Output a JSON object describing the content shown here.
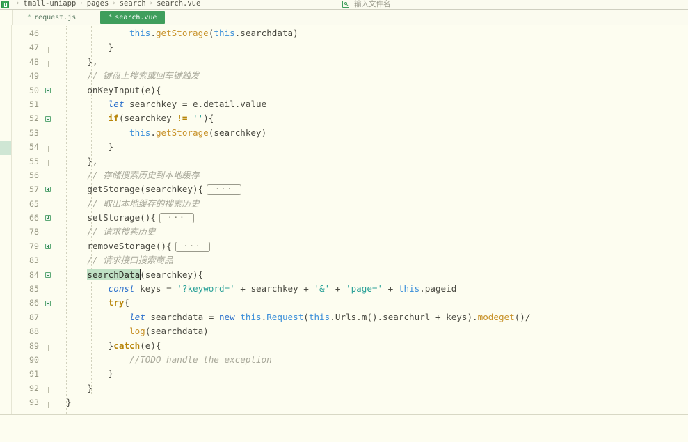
{
  "breadcrumb": {
    "app_icon": "app-logo-icon",
    "items": [
      "tmall-uniapp",
      "pages",
      "search",
      "search.vue"
    ],
    "separator": "›"
  },
  "search": {
    "icon": "search-icon",
    "placeholder": "输入文件名",
    "value": ""
  },
  "tabs": [
    {
      "label": "request.js",
      "modified_marker": "*",
      "active": false
    },
    {
      "label": "search.vue",
      "modified_marker": "*",
      "active": true
    }
  ],
  "editor": {
    "fold_placeholder": "···",
    "selection": "searchData",
    "lines": [
      {
        "num": "46",
        "fold": "none",
        "indent": 0
      },
      {
        "num": "47",
        "fold": "tick",
        "indent": 0
      },
      {
        "num": "48",
        "fold": "tick",
        "indent": 0
      },
      {
        "num": "49",
        "fold": "none",
        "indent": 0
      },
      {
        "num": "50",
        "fold": "expanded",
        "indent": 0
      },
      {
        "num": "51",
        "fold": "none",
        "indent": 0
      },
      {
        "num": "52",
        "fold": "expanded",
        "indent": 0
      },
      {
        "num": "53",
        "fold": "none",
        "indent": 0
      },
      {
        "num": "54",
        "fold": "tick",
        "indent": 0
      },
      {
        "num": "55",
        "fold": "tick",
        "indent": 0
      },
      {
        "num": "56",
        "fold": "none",
        "indent": 0
      },
      {
        "num": "57",
        "fold": "collapsed",
        "indent": 0
      },
      {
        "num": "65",
        "fold": "none",
        "indent": 0
      },
      {
        "num": "66",
        "fold": "collapsed",
        "indent": 0
      },
      {
        "num": "78",
        "fold": "none",
        "indent": 0
      },
      {
        "num": "79",
        "fold": "collapsed",
        "indent": 0
      },
      {
        "num": "83",
        "fold": "none",
        "indent": 0
      },
      {
        "num": "84",
        "fold": "expanded",
        "indent": 0
      },
      {
        "num": "85",
        "fold": "none",
        "indent": 0
      },
      {
        "num": "86",
        "fold": "expanded",
        "indent": 0
      },
      {
        "num": "87",
        "fold": "none",
        "indent": 0
      },
      {
        "num": "88",
        "fold": "none",
        "indent": 0
      },
      {
        "num": "89",
        "fold": "tick",
        "indent": 0
      },
      {
        "num": "90",
        "fold": "none",
        "indent": 0
      },
      {
        "num": "91",
        "fold": "none",
        "indent": 0
      },
      {
        "num": "92",
        "fold": "tick",
        "indent": 0
      },
      {
        "num": "93",
        "fold": "tick",
        "indent": 0
      }
    ],
    "code": {
      "l46": "            this.getStorage(this.searchdata)",
      "l47": "        }",
      "l48": "    },",
      "l49": "    // 键盘上搜索或回车键触发",
      "l50": "    onKeyInput(e){",
      "l51": "        let searchkey = e.detail.value",
      "l52": "        if(searchkey != ''){",
      "l53": "            this.getStorage(searchkey)",
      "l54": "        }",
      "l55": "    },",
      "l56": "    // 存储搜索历史到本地缓存",
      "l57": "    getStorage(searchkey){",
      "l65": "    // 取出本地缓存的搜索历史",
      "l66": "    setStorage(){",
      "l78": "    // 请求搜索历史",
      "l79": "    removeStorage(){",
      "l83": "    // 请求接口搜索商品",
      "l84": "    searchData(searchkey){",
      "l85": "        const keys = '?keyword=' + searchkey + '&' + 'page=' + this.pageid",
      "l86": "        try{",
      "l87": "            let searchdata = new this.Request(this.Urls.m().searchurl + keys).modeget()/",
      "l88": "            log(searchdata)",
      "l89": "        }catch(e){",
      "l90": "            //TODO handle the exception",
      "l91": "        }",
      "l92": "    }",
      "l93": "}"
    }
  },
  "colors": {
    "editor_background": "#fdfdf0",
    "accent_green": "#3f9e5c",
    "keyword_blue": "#2a6fcb",
    "keyword_gold": "#b8860b",
    "method_gold": "#c8922a",
    "string_teal": "#2aa198",
    "comment_gray": "#a8a89a",
    "selection_green": "#bfe0c4",
    "line_number_gray": "#9a9a86"
  }
}
